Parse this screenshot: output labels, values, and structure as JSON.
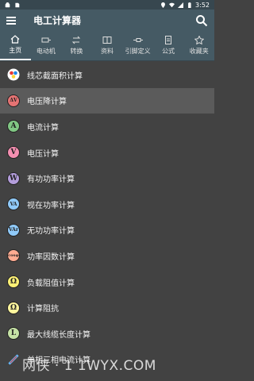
{
  "status_bar": {
    "time": "3:52"
  },
  "app_bar": {
    "title": "电工计算器"
  },
  "tabs": [
    {
      "label": "主页",
      "icon": "home-icon",
      "active": true
    },
    {
      "label": "电动机",
      "icon": "motor-icon"
    },
    {
      "label": "转换",
      "icon": "swap-icon"
    },
    {
      "label": "资料",
      "icon": "book-icon"
    },
    {
      "label": "引脚定义",
      "icon": "pin-icon"
    },
    {
      "label": "公式",
      "icon": "formula-icon"
    },
    {
      "label": "收藏夹",
      "icon": "star-icon"
    }
  ],
  "list": {
    "items": [
      {
        "label": "线芯截面积计算",
        "badge": "",
        "color": "#ffffff"
      },
      {
        "label": "电压降计算",
        "badge": "ΔV",
        "color": "#e57373"
      },
      {
        "label": "电流计算",
        "badge": "A",
        "color": "#81c784"
      },
      {
        "label": "电压计算",
        "badge": "V",
        "color": "#f48fb1"
      },
      {
        "label": "有功功率计算",
        "badge": "W",
        "color": "#b39ddb"
      },
      {
        "label": "视在功率计算",
        "badge": "VA",
        "color": "#90caf9"
      },
      {
        "label": "无功功率计算",
        "badge": "VAr",
        "color": "#90caf9"
      },
      {
        "label": "功率因数计算",
        "badge": "cosφ",
        "color": "#ffab91"
      },
      {
        "label": "负载阻值计算",
        "badge": "Ω",
        "color": "#fff176"
      },
      {
        "label": "计算阻抗",
        "badge": "Ω",
        "color": "#fff59d"
      },
      {
        "label": "最大线缆长度计算",
        "badge": "L",
        "color": "#c5e1a5"
      },
      {
        "label": "单相三相电流计算",
        "badge": "",
        "color": "#64b5f6"
      }
    ]
  },
  "watermark": "网侠 · 1 1WYX.COM"
}
